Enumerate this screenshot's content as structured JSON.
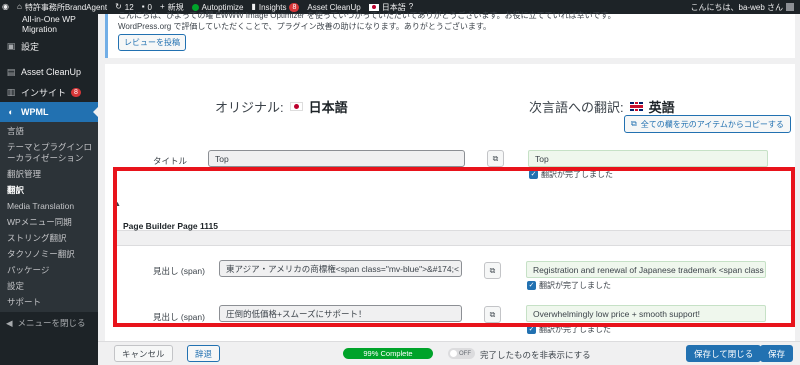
{
  "adminbar": {
    "site_name": "特許事務所BrandAgent",
    "updates_count": "12",
    "comments_count": "0",
    "new_label": "新規",
    "autoptimize_label": "Autoptimize",
    "insights_label": "Insights",
    "insights_badge": "8",
    "asset_cleanup_label": "Asset CleanUp",
    "language_label": "日本語",
    "greeting": "こんにちは、ba-web さん",
    "status_colors": {
      "autoptimize": "#00a32a",
      "badge": "#d63638"
    }
  },
  "sidebar": {
    "top_item": "All-in-One WP Migration",
    "items": [
      {
        "label": "設定",
        "icon": "settings-icon"
      },
      {
        "label": "Asset CleanUp",
        "icon": "asset-cleanup-icon"
      },
      {
        "label": "インサイト",
        "icon": "insights-icon",
        "badge": "8"
      },
      {
        "label": "WPML",
        "icon": "wpml-icon",
        "active": true
      }
    ],
    "submenu": [
      "言語",
      "テーマとプラグインローカライゼーション",
      "翻訳管理",
      "翻訳",
      "Media Translation",
      "WPメニュー同期",
      "ストリング翻訳",
      "タクソノミー翻訳",
      "パッケージ",
      "設定",
      "サポート"
    ],
    "collapse_label": "メニューを閉じる"
  },
  "notice": {
    "line_cut": "こんにちは、ひよっての曜 EWWW Image Optimizer を使っていつかっていただいてありがとうございます。お役に立てていれば幸いです。",
    "line": "WordPress.org で評価していただくことで、プラグイン改善の助けになります。ありがとうございます。",
    "review_button": "レビューを投稿"
  },
  "editor": {
    "original_label": "オリジナル:",
    "original_lang": "日本語",
    "translation_label": "次言語への翻訳:",
    "translation_lang": "英語",
    "copy_all_button": "全ての欄を元のアイテムからコピーする",
    "title_row": {
      "label": "タイトル",
      "source": "Top",
      "translation": "Top",
      "done_label": "翻訳が完了しました"
    },
    "section_title": "Page Builder Page 1115",
    "rows": [
      {
        "label": "見出し (span)",
        "source": "東アジア・アメリカの商標権<span class=\"mv-blue\">&#174;<",
        "translation": "Registration and renewal of Japanese trademark <span class =",
        "done_label": "翻訳が完了しました"
      },
      {
        "label": "見出し (span)",
        "source": "圧倒的低価格+スムーズにサポート！",
        "translation": "Overwhelmingly low price + smooth support!",
        "done_label": "翻訳が完了しました"
      }
    ]
  },
  "footer": {
    "cancel_button": "キャンセル",
    "resign_button": "辞退",
    "progress_label": "99% Complete",
    "progress_value": 0.99,
    "toggle_state": "OFF",
    "toggle_label": "完了したものを非表示にする",
    "save_close_button": "保存して閉じる",
    "save_button": "保存"
  },
  "colors": {
    "accent": "#2271b1",
    "highlight": "#e8131b",
    "progress": "#00a32a",
    "translation_bg": "#eff7ed"
  }
}
